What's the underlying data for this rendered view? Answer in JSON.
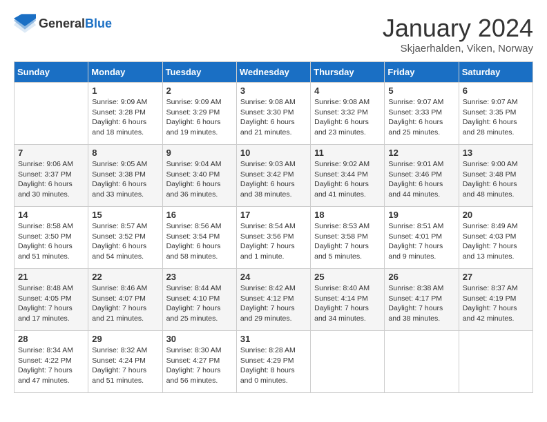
{
  "logo": {
    "general": "General",
    "blue": "Blue"
  },
  "header": {
    "month_year": "January 2024",
    "location": "Skjaerhalden, Viken, Norway"
  },
  "days_of_week": [
    "Sunday",
    "Monday",
    "Tuesday",
    "Wednesday",
    "Thursday",
    "Friday",
    "Saturday"
  ],
  "weeks": [
    [
      {
        "day": "",
        "sunrise": "",
        "sunset": "",
        "daylight": ""
      },
      {
        "day": "1",
        "sunrise": "Sunrise: 9:09 AM",
        "sunset": "Sunset: 3:28 PM",
        "daylight": "Daylight: 6 hours and 18 minutes."
      },
      {
        "day": "2",
        "sunrise": "Sunrise: 9:09 AM",
        "sunset": "Sunset: 3:29 PM",
        "daylight": "Daylight: 6 hours and 19 minutes."
      },
      {
        "day": "3",
        "sunrise": "Sunrise: 9:08 AM",
        "sunset": "Sunset: 3:30 PM",
        "daylight": "Daylight: 6 hours and 21 minutes."
      },
      {
        "day": "4",
        "sunrise": "Sunrise: 9:08 AM",
        "sunset": "Sunset: 3:32 PM",
        "daylight": "Daylight: 6 hours and 23 minutes."
      },
      {
        "day": "5",
        "sunrise": "Sunrise: 9:07 AM",
        "sunset": "Sunset: 3:33 PM",
        "daylight": "Daylight: 6 hours and 25 minutes."
      },
      {
        "day": "6",
        "sunrise": "Sunrise: 9:07 AM",
        "sunset": "Sunset: 3:35 PM",
        "daylight": "Daylight: 6 hours and 28 minutes."
      }
    ],
    [
      {
        "day": "7",
        "sunrise": "Sunrise: 9:06 AM",
        "sunset": "Sunset: 3:37 PM",
        "daylight": "Daylight: 6 hours and 30 minutes."
      },
      {
        "day": "8",
        "sunrise": "Sunrise: 9:05 AM",
        "sunset": "Sunset: 3:38 PM",
        "daylight": "Daylight: 6 hours and 33 minutes."
      },
      {
        "day": "9",
        "sunrise": "Sunrise: 9:04 AM",
        "sunset": "Sunset: 3:40 PM",
        "daylight": "Daylight: 6 hours and 36 minutes."
      },
      {
        "day": "10",
        "sunrise": "Sunrise: 9:03 AM",
        "sunset": "Sunset: 3:42 PM",
        "daylight": "Daylight: 6 hours and 38 minutes."
      },
      {
        "day": "11",
        "sunrise": "Sunrise: 9:02 AM",
        "sunset": "Sunset: 3:44 PM",
        "daylight": "Daylight: 6 hours and 41 minutes."
      },
      {
        "day": "12",
        "sunrise": "Sunrise: 9:01 AM",
        "sunset": "Sunset: 3:46 PM",
        "daylight": "Daylight: 6 hours and 44 minutes."
      },
      {
        "day": "13",
        "sunrise": "Sunrise: 9:00 AM",
        "sunset": "Sunset: 3:48 PM",
        "daylight": "Daylight: 6 hours and 48 minutes."
      }
    ],
    [
      {
        "day": "14",
        "sunrise": "Sunrise: 8:58 AM",
        "sunset": "Sunset: 3:50 PM",
        "daylight": "Daylight: 6 hours and 51 minutes."
      },
      {
        "day": "15",
        "sunrise": "Sunrise: 8:57 AM",
        "sunset": "Sunset: 3:52 PM",
        "daylight": "Daylight: 6 hours and 54 minutes."
      },
      {
        "day": "16",
        "sunrise": "Sunrise: 8:56 AM",
        "sunset": "Sunset: 3:54 PM",
        "daylight": "Daylight: 6 hours and 58 minutes."
      },
      {
        "day": "17",
        "sunrise": "Sunrise: 8:54 AM",
        "sunset": "Sunset: 3:56 PM",
        "daylight": "Daylight: 7 hours and 1 minute."
      },
      {
        "day": "18",
        "sunrise": "Sunrise: 8:53 AM",
        "sunset": "Sunset: 3:58 PM",
        "daylight": "Daylight: 7 hours and 5 minutes."
      },
      {
        "day": "19",
        "sunrise": "Sunrise: 8:51 AM",
        "sunset": "Sunset: 4:01 PM",
        "daylight": "Daylight: 7 hours and 9 minutes."
      },
      {
        "day": "20",
        "sunrise": "Sunrise: 8:49 AM",
        "sunset": "Sunset: 4:03 PM",
        "daylight": "Daylight: 7 hours and 13 minutes."
      }
    ],
    [
      {
        "day": "21",
        "sunrise": "Sunrise: 8:48 AM",
        "sunset": "Sunset: 4:05 PM",
        "daylight": "Daylight: 7 hours and 17 minutes."
      },
      {
        "day": "22",
        "sunrise": "Sunrise: 8:46 AM",
        "sunset": "Sunset: 4:07 PM",
        "daylight": "Daylight: 7 hours and 21 minutes."
      },
      {
        "day": "23",
        "sunrise": "Sunrise: 8:44 AM",
        "sunset": "Sunset: 4:10 PM",
        "daylight": "Daylight: 7 hours and 25 minutes."
      },
      {
        "day": "24",
        "sunrise": "Sunrise: 8:42 AM",
        "sunset": "Sunset: 4:12 PM",
        "daylight": "Daylight: 7 hours and 29 minutes."
      },
      {
        "day": "25",
        "sunrise": "Sunrise: 8:40 AM",
        "sunset": "Sunset: 4:14 PM",
        "daylight": "Daylight: 7 hours and 34 minutes."
      },
      {
        "day": "26",
        "sunrise": "Sunrise: 8:38 AM",
        "sunset": "Sunset: 4:17 PM",
        "daylight": "Daylight: 7 hours and 38 minutes."
      },
      {
        "day": "27",
        "sunrise": "Sunrise: 8:37 AM",
        "sunset": "Sunset: 4:19 PM",
        "daylight": "Daylight: 7 hours and 42 minutes."
      }
    ],
    [
      {
        "day": "28",
        "sunrise": "Sunrise: 8:34 AM",
        "sunset": "Sunset: 4:22 PM",
        "daylight": "Daylight: 7 hours and 47 minutes."
      },
      {
        "day": "29",
        "sunrise": "Sunrise: 8:32 AM",
        "sunset": "Sunset: 4:24 PM",
        "daylight": "Daylight: 7 hours and 51 minutes."
      },
      {
        "day": "30",
        "sunrise": "Sunrise: 8:30 AM",
        "sunset": "Sunset: 4:27 PM",
        "daylight": "Daylight: 7 hours and 56 minutes."
      },
      {
        "day": "31",
        "sunrise": "Sunrise: 8:28 AM",
        "sunset": "Sunset: 4:29 PM",
        "daylight": "Daylight: 8 hours and 0 minutes."
      },
      {
        "day": "",
        "sunrise": "",
        "sunset": "",
        "daylight": ""
      },
      {
        "day": "",
        "sunrise": "",
        "sunset": "",
        "daylight": ""
      },
      {
        "day": "",
        "sunrise": "",
        "sunset": "",
        "daylight": ""
      }
    ]
  ]
}
